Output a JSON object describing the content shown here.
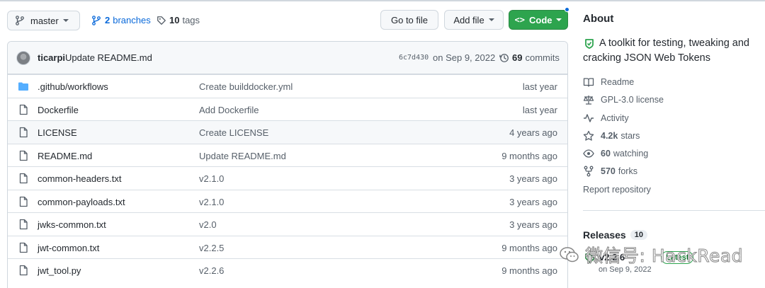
{
  "toolbar": {
    "branch_label": "master",
    "branches_count": "2",
    "branches_label": "branches",
    "tags_count": "10",
    "tags_label": "tags",
    "go_to_file": "Go to file",
    "add_file": "Add file",
    "code": "Code"
  },
  "commit": {
    "author": "ticarpi",
    "message": "Update README.md",
    "sha": "6c7d430",
    "date": "on Sep 9, 2022",
    "commits_count": "69",
    "commits_label": "commits"
  },
  "files": [
    {
      "name": ".github/workflows",
      "type": "folder",
      "message": "Create builddocker.yml",
      "age": "last year"
    },
    {
      "name": "Dockerfile",
      "type": "file",
      "message": "Add Dockerfile",
      "age": "last year"
    },
    {
      "name": "LICENSE",
      "type": "file",
      "message": "Create LICENSE",
      "age": "4 years ago"
    },
    {
      "name": "README.md",
      "type": "file",
      "message": "Update README.md",
      "age": "9 months ago"
    },
    {
      "name": "common-headers.txt",
      "type": "file",
      "message": "v2.1.0",
      "age": "3 years ago"
    },
    {
      "name": "common-payloads.txt",
      "type": "file",
      "message": "v2.1.0",
      "age": "3 years ago"
    },
    {
      "name": "jwks-common.txt",
      "type": "file",
      "message": "v2.0",
      "age": "3 years ago"
    },
    {
      "name": "jwt-common.txt",
      "type": "file",
      "message": "v2.2.5",
      "age": "9 months ago"
    },
    {
      "name": "jwt_tool.py",
      "type": "file",
      "message": "v2.2.6",
      "age": "9 months ago"
    }
  ],
  "about": {
    "title": "About",
    "description": "A toolkit for testing, tweaking and cracking JSON Web Tokens",
    "readme": "Readme",
    "license": "GPL-3.0 license",
    "activity": "Activity",
    "stars_count": "4.2k",
    "stars_label": "stars",
    "watching_count": "60",
    "watching_label": "watching",
    "forks_count": "570",
    "forks_label": "forks",
    "report": "Report repository"
  },
  "releases": {
    "title": "Releases",
    "count": "10",
    "latest_name": "v2.2.6",
    "latest_badge": "Latest",
    "latest_date": "on Sep 9, 2022"
  },
  "watermark": {
    "text": "微信号: HackRead"
  },
  "colors": {
    "accent_blue": "#0969da",
    "code_green": "#2da44e",
    "folder_blue": "#54aeff",
    "muted_text": "#57606a"
  }
}
